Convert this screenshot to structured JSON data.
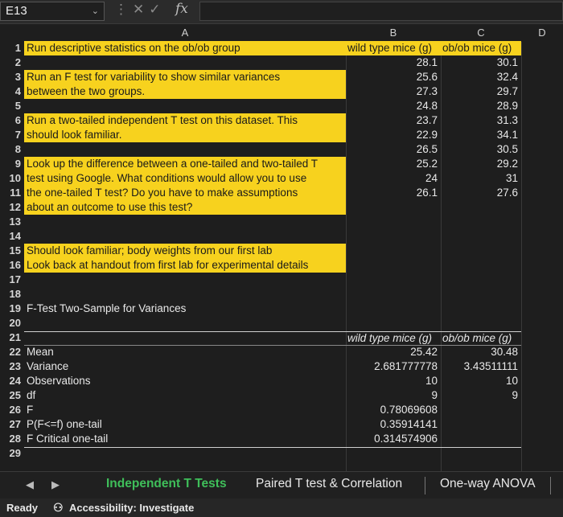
{
  "formula_bar": {
    "name_box": "E13",
    "fx_label": "fx"
  },
  "columns": [
    "A",
    "B",
    "C",
    "D"
  ],
  "rows": [
    "1",
    "2",
    "3",
    "4",
    "5",
    "6",
    "7",
    "8",
    "9",
    "10",
    "11",
    "12",
    "13",
    "14",
    "15",
    "16",
    "17",
    "18",
    "19",
    "20",
    "21",
    "22",
    "23",
    "24",
    "25",
    "26",
    "27",
    "28",
    "29"
  ],
  "instructions": {
    "r1": "Run descriptive statistics on the ob/ob group",
    "r3": "Run an F test for variability to show similar variances",
    "r4": "between the two groups.",
    "r6": "Run a two-tailed independent T test on this dataset. This",
    "r7": "should look familiar.",
    "r9": "Look up the difference between a one-tailed and two-tailed T",
    "r10": "test using Google. What conditions would allow you to use",
    "r11": "the one-tailed T test? Do you have to make assumptions",
    "r12": "about an outcome to use this test?",
    "r15": "Should look familiar; body weights from our first lab",
    "r16": "Look back at handout from first lab for experimental details"
  },
  "data_table": {
    "header_b": "wild type mice (g)",
    "header_c": "ob/ob mice (g)",
    "wild_type": [
      "28.1",
      "25.6",
      "27.3",
      "24.8",
      "23.7",
      "22.9",
      "26.5",
      "25.2",
      "24",
      "26.1"
    ],
    "ob_ob": [
      "30.1",
      "32.4",
      "29.7",
      "28.9",
      "31.3",
      "34.1",
      "30.5",
      "29.2",
      "31",
      "27.6"
    ]
  },
  "ftest": {
    "title": "F-Test Two-Sample for Variances",
    "header_b": "wild type mice (g)",
    "header_c": "ob/ob mice (g)",
    "rows": [
      {
        "label": "Mean",
        "b": "25.42",
        "c": "30.48"
      },
      {
        "label": "Variance",
        "b": "2.681777778",
        "c": "3.43511111"
      },
      {
        "label": "Observations",
        "b": "10",
        "c": "10"
      },
      {
        "label": "df",
        "b": "9",
        "c": "9"
      },
      {
        "label": "F",
        "b": "0.78069608",
        "c": ""
      },
      {
        "label": "P(F<=f) one-tail",
        "b": "0.35914141",
        "c": ""
      },
      {
        "label": "F Critical one-tail",
        "b": "0.314574906",
        "c": ""
      }
    ]
  },
  "sheet_tabs": {
    "prev": "◀",
    "next": "▶",
    "tabs": [
      "Independent T Tests",
      "Paired T test & Correlation",
      "One-way ANOVA"
    ]
  },
  "status_bar": {
    "ready": "Ready",
    "accessibility": "Accessibility: Investigate"
  }
}
